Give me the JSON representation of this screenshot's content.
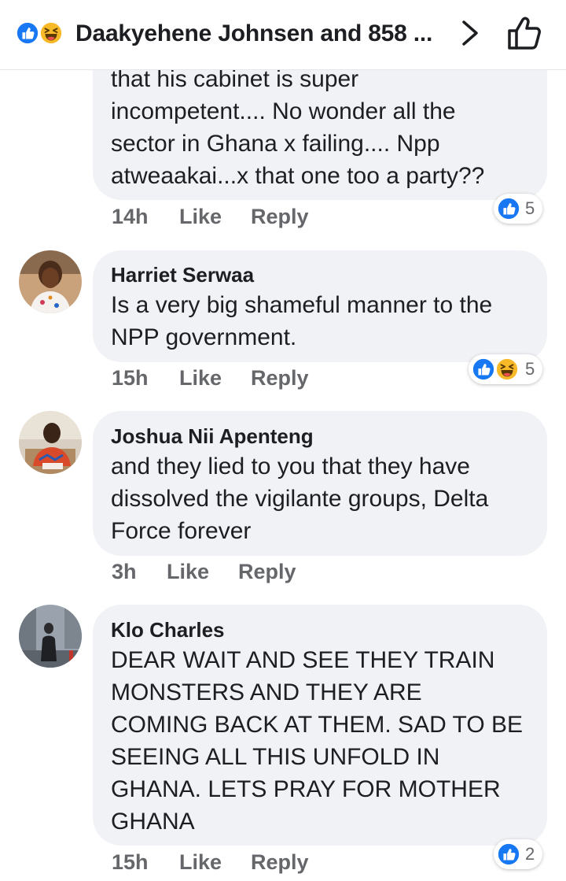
{
  "header": {
    "title": "Daakyehene Johnsen and 858 ...",
    "reactions": [
      "like-icon",
      "haha-icon"
    ]
  },
  "colors": {
    "like_blue": "#1877f2",
    "haha_yellow": "#f7b928",
    "bubble_bg": "#f0f2f5",
    "meta_gray": "#65676b"
  },
  "comments": [
    {
      "text_lines": [
        "that his cabinet is super",
        "incompetent.... No wonder all the",
        "sector in Ghana  x failing.... Npp",
        "atweaakai...x that one too a party??"
      ],
      "time": "14h",
      "like_label": "Like",
      "reply_label": "Reply",
      "reaction_count": "5"
    },
    {
      "author": "Harriet Serwaa",
      "text_lines": [
        "Is a very big shameful manner to the",
        "NPP government."
      ],
      "time": "15h",
      "like_label": "Like",
      "reply_label": "Reply",
      "reaction_count": "5"
    },
    {
      "author": "Joshua Nii Apenteng",
      "text_lines": [
        "and they lied to you that they have",
        "dissolved the vigilante groups,  Delta",
        "Force forever"
      ],
      "time": "3h",
      "like_label": "Like",
      "reply_label": "Reply"
    },
    {
      "author": "Klo Charles",
      "text_lines": [
        "DEAR WAIT AND SEE  THEY TRAIN",
        "MONSTERS  AND THEY ARE",
        "COMING BACK AT THEM. SAD TO BE",
        "SEEING  ALL THIS UNFOLD  IN",
        "GHANA. LETS PRAY FOR MOTHER",
        "GHANA"
      ],
      "time": "15h",
      "like_label": "Like",
      "reply_label": "Reply",
      "reaction_count": "2"
    }
  ]
}
